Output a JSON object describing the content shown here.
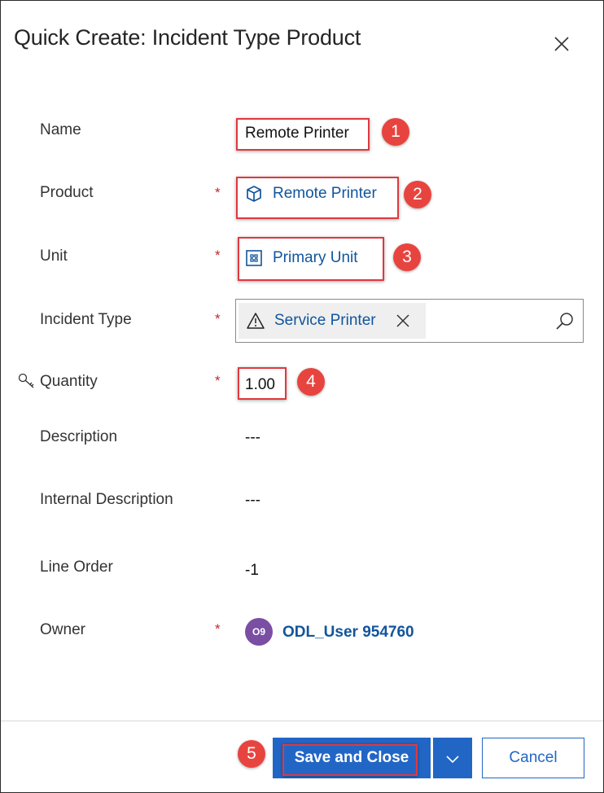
{
  "dialog": {
    "title": "Quick Create: Incident Type Product"
  },
  "fields": {
    "name": {
      "label": "Name",
      "value": "Remote Printer"
    },
    "product": {
      "label": "Product",
      "required": "*",
      "value": "Remote Printer"
    },
    "unit": {
      "label": "Unit",
      "required": "*",
      "value": "Primary Unit"
    },
    "incident_type": {
      "label": "Incident Type",
      "required": "*",
      "value": "Service Printer"
    },
    "quantity": {
      "label": "Quantity",
      "required": "*",
      "value": "1.00"
    },
    "description": {
      "label": "Description",
      "value": "---"
    },
    "internal_description": {
      "label": "Internal Description",
      "value": "---"
    },
    "line_order": {
      "label": "Line Order",
      "value": "-1"
    },
    "owner": {
      "label": "Owner",
      "required": "*",
      "initials": "O9",
      "value": "ODL_User 954760"
    }
  },
  "callouts": [
    "1",
    "2",
    "3",
    "4",
    "5"
  ],
  "footer": {
    "save_label": "Save and Close",
    "cancel_label": "Cancel"
  },
  "colors": {
    "accent": "#2266c5",
    "link": "#11559c",
    "required": "#c4262e",
    "callout": "#e8443f",
    "avatar": "#7a4ea3"
  },
  "icons": [
    "close-icon",
    "product-box-icon",
    "unit-icon",
    "warning-icon",
    "search-icon",
    "key-icon",
    "chevron-down-icon"
  ]
}
